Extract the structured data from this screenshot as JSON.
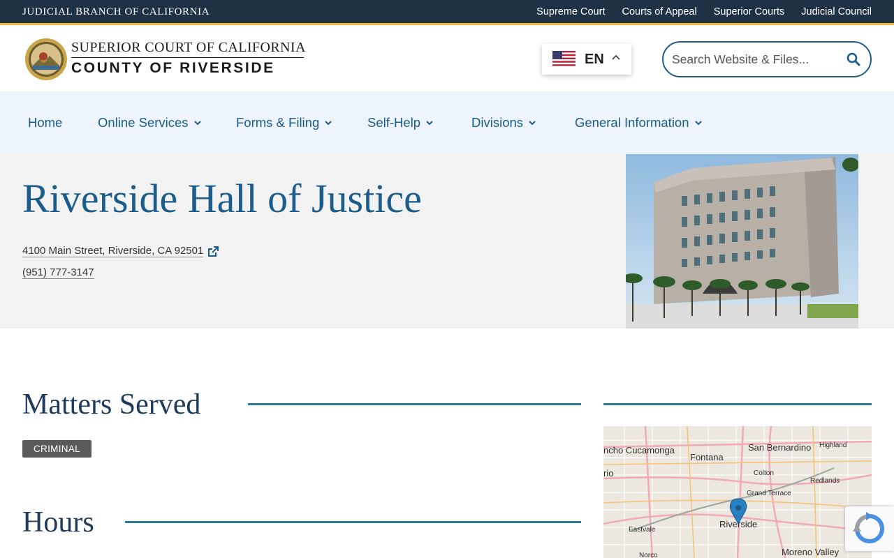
{
  "topbar": {
    "branch": "JUDICIAL BRANCH OF CALIFORNIA",
    "links": [
      "Supreme Court",
      "Courts of Appeal",
      "Superior Courts",
      "Judicial Council"
    ]
  },
  "header": {
    "court_line1": "SUPERIOR COURT OF CALIFORNIA",
    "court_line2": "COUNTY OF RIVERSIDE",
    "language": "EN",
    "search_placeholder": "Search Website & Files..."
  },
  "nav": {
    "home": "Home",
    "online_services": "Online Services",
    "forms_filing": "Forms & Filing",
    "self_help": "Self-Help",
    "divisions": "Divisions",
    "general_information": "General Information"
  },
  "hero": {
    "title": "Riverside Hall of Justice",
    "address": "4100 Main Street, Riverside, CA 92501",
    "phone": "(951) 777-3147"
  },
  "matters": {
    "title": "Matters Served",
    "badges": [
      "CRIMINAL"
    ]
  },
  "hours": {
    "title": "Hours"
  },
  "map": {
    "labels": [
      "ncho Cucamonga",
      "Fontana",
      "San Bernardino",
      "Highland",
      "Colton",
      "Redlands",
      "Grand Terrace",
      "Riverside",
      "Eastvale",
      "Norco",
      "Moreno Valley",
      "rio"
    ]
  },
  "colors": {
    "topbar": "#1f3245",
    "accent": "#f1b83d",
    "brand_blue": "#1b5c8a",
    "nav_bg": "#edf4fb",
    "hero_bg": "#f2f2f2",
    "rule": "#2b7a8f"
  }
}
